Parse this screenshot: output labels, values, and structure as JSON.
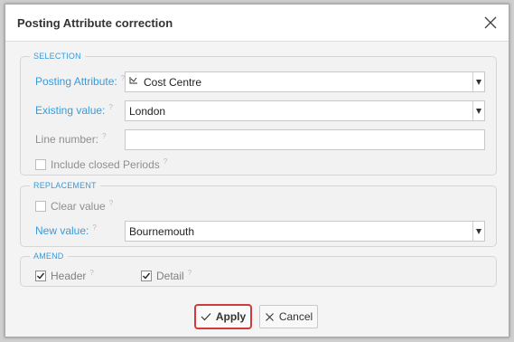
{
  "dialog": {
    "title": "Posting Attribute correction"
  },
  "selection": {
    "legend": "SELECTION",
    "posting_attribute": {
      "label": "Posting Attribute:",
      "value": "Cost Centre"
    },
    "existing_value": {
      "label": "Existing value:",
      "value": "London"
    },
    "line_number": {
      "label": "Line number:",
      "value": ""
    },
    "include_closed": {
      "label": "Include closed Periods",
      "checked": false
    }
  },
  "replacement": {
    "legend": "REPLACEMENT",
    "clear_value": {
      "label": "Clear value",
      "checked": false
    },
    "new_value": {
      "label": "New value:",
      "value": "Bournemouth"
    }
  },
  "amend": {
    "legend": "AMEND",
    "header": {
      "label": "Header",
      "checked": true
    },
    "detail": {
      "label": "Detail",
      "checked": true
    }
  },
  "buttons": {
    "apply": "Apply",
    "cancel": "Cancel"
  },
  "help_glyph": "?",
  "colors": {
    "accent_label": "#3a9ad9",
    "apply_highlight": "#d13a3a"
  }
}
